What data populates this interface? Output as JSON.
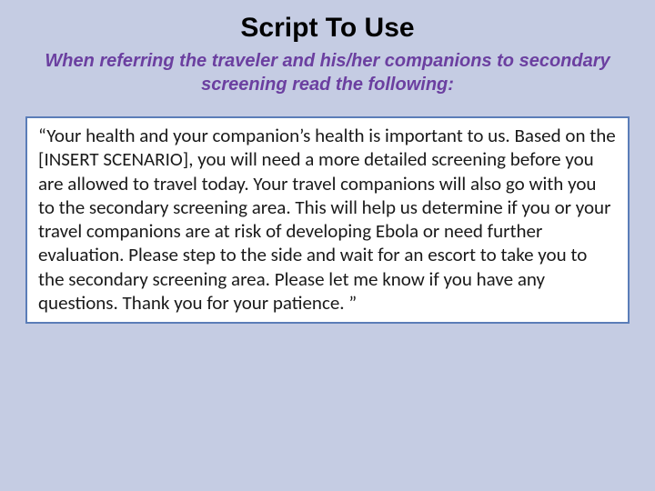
{
  "title": "Script To Use",
  "subtitle": "When referring the traveler and his/her companions to secondary screening read the following:",
  "script_text": "“Your health and your companion’s health is important to us. Based on the [INSERT SCENARIO], you will need a more detailed screening before you are allowed to travel today. Your travel companions will also go with you to the secondary screening area. This will help us determine if you or your travel companions are at risk of developing Ebola or need further evaluation. Please step to the side and wait for an escort to take you to the secondary screening area. Please let me know if you have any questions. Thank you for your patience. ”"
}
